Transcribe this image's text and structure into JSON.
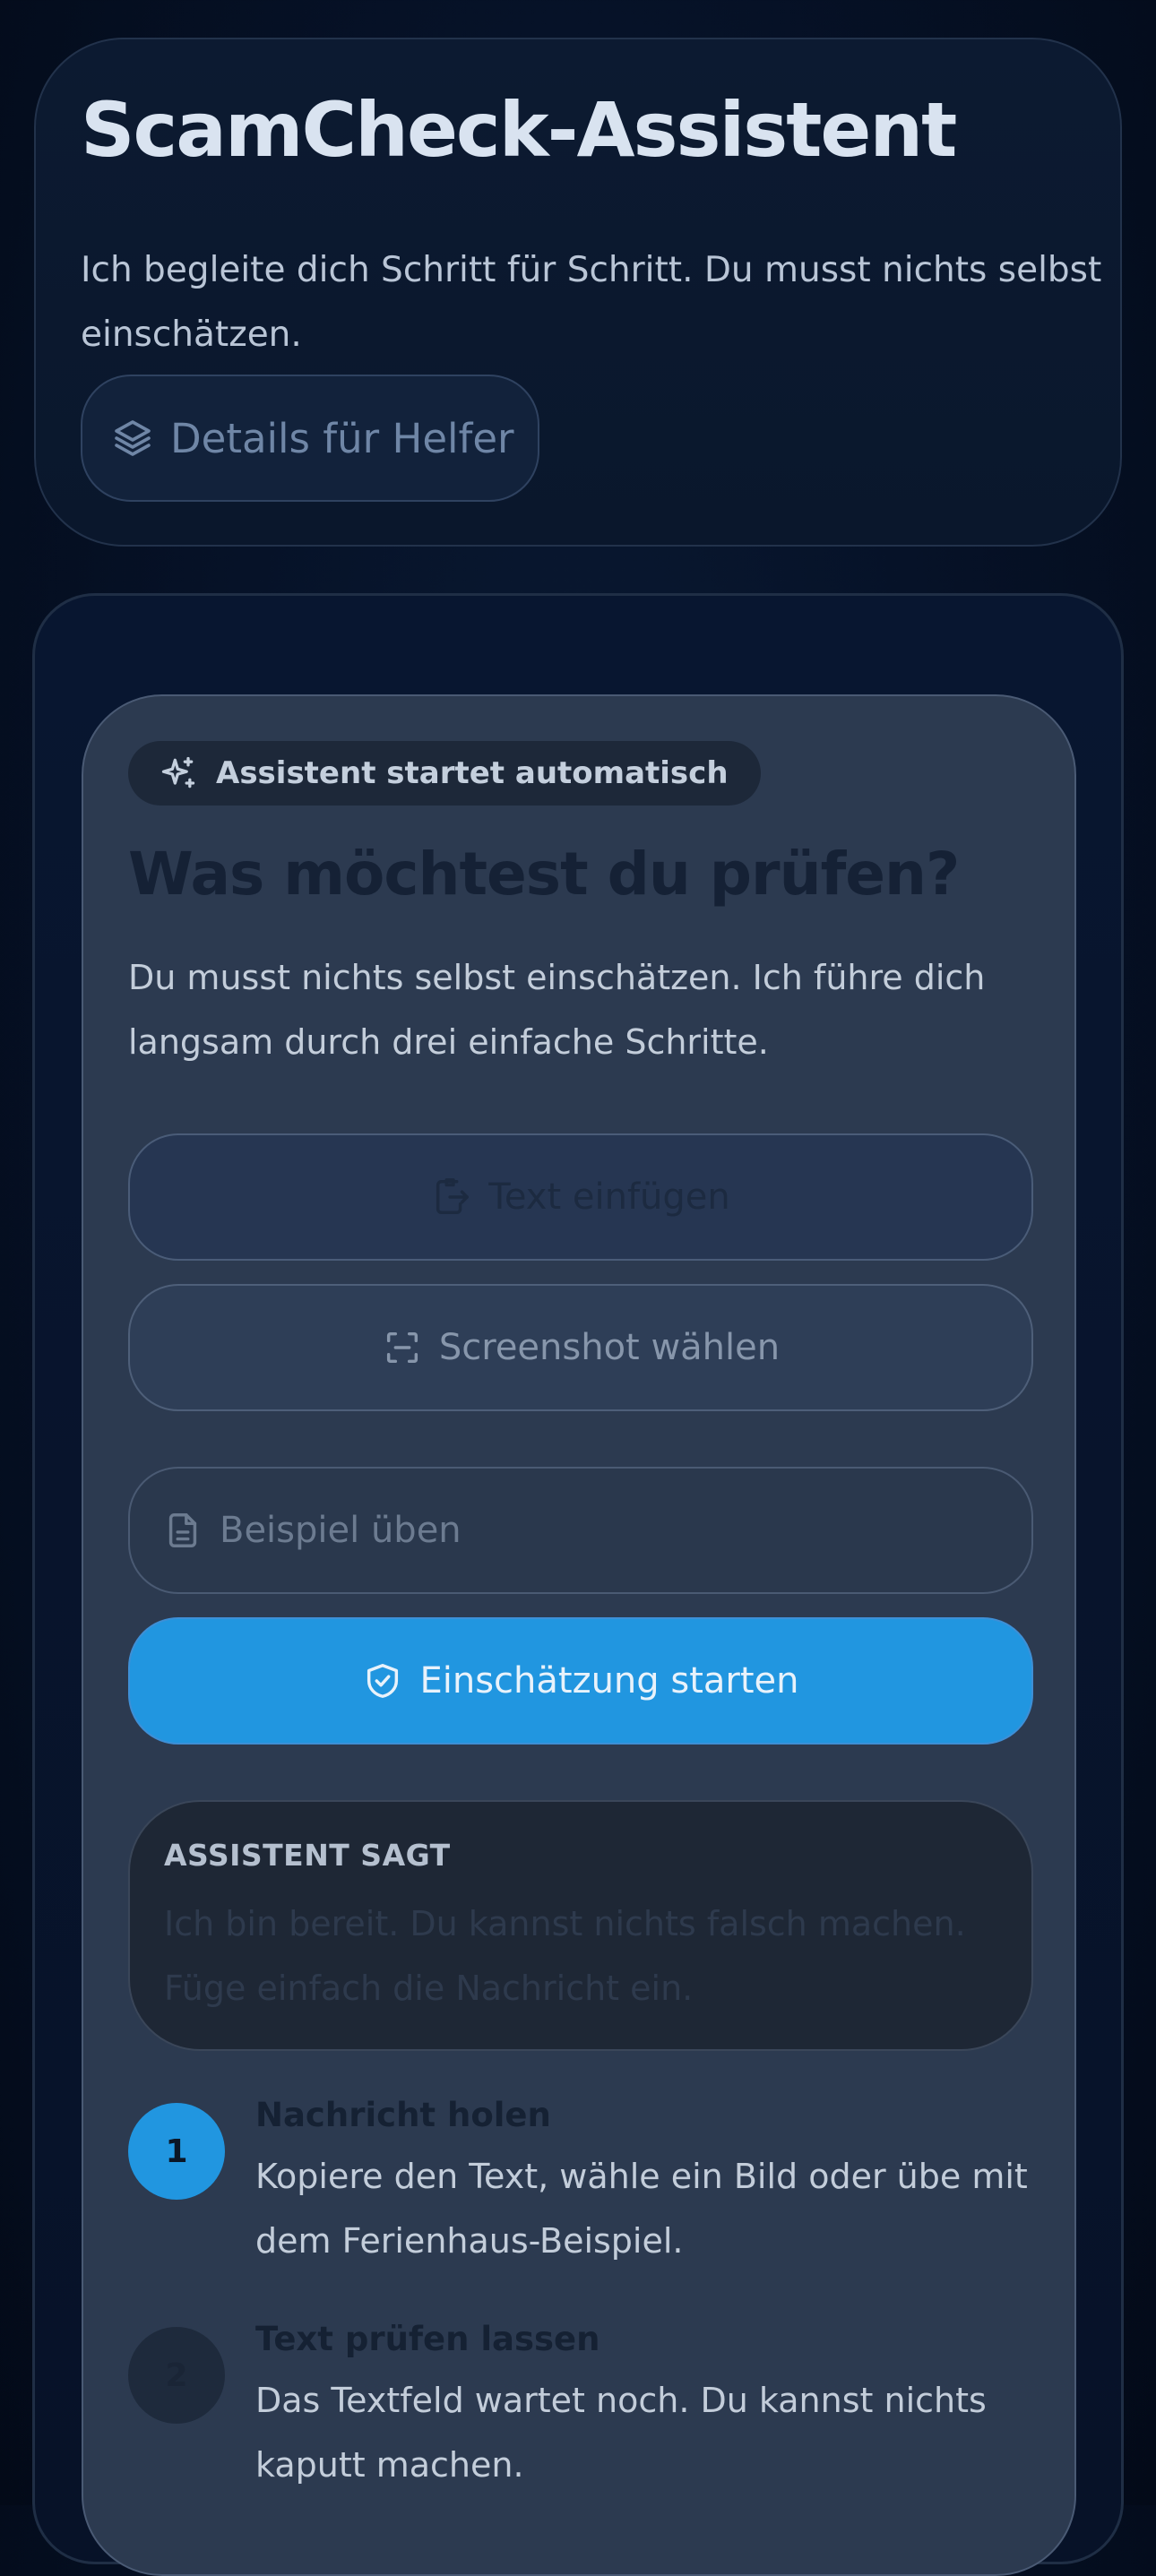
{
  "header": {
    "title": "ScamCheck-Assistent",
    "subtitle": "Ich begleite dich Schritt für Schritt. Du musst nichts selbst einschätzen.",
    "helper_button": {
      "label": "Details für Helfer",
      "icon": "layers-icon"
    }
  },
  "assistant": {
    "badge": {
      "label": "Assistent startet automatisch",
      "icon": "sparkles-icon"
    },
    "question": "Was möchtest du prüfen?",
    "intro": "Du musst nichts selbst einschätzen. Ich führe dich langsam durch drei einfache Schritte.",
    "actions": {
      "paste_text": {
        "label": "Text einfügen",
        "icon": "paste-icon"
      },
      "choose_screenshot": {
        "label": "Screenshot wählen",
        "icon": "scan-icon"
      },
      "practice_example": {
        "label": "Beispiel üben",
        "icon": "document-icon"
      },
      "start_assessment": {
        "label": "Einschätzung starten",
        "icon": "shield-check-icon"
      }
    },
    "says": {
      "label": "ASSISTENT SAGT",
      "text": "Ich bin bereit. Du kannst nichts falsch machen. Füge einfach die Nachricht ein."
    },
    "steps": [
      {
        "number": "1",
        "title": "Nachricht holen",
        "text": "Kopiere den Text, wähle ein Bild oder übe mit dem Ferienhaus-Beispiel."
      },
      {
        "number": "2",
        "title": "Text prüfen lassen",
        "text": "Das Textfeld wartet noch. Du kannst nichts kaputt machen."
      }
    ]
  },
  "colors": {
    "background": "#061228",
    "accent": "#2196e0",
    "panel": "#2c3a50"
  }
}
